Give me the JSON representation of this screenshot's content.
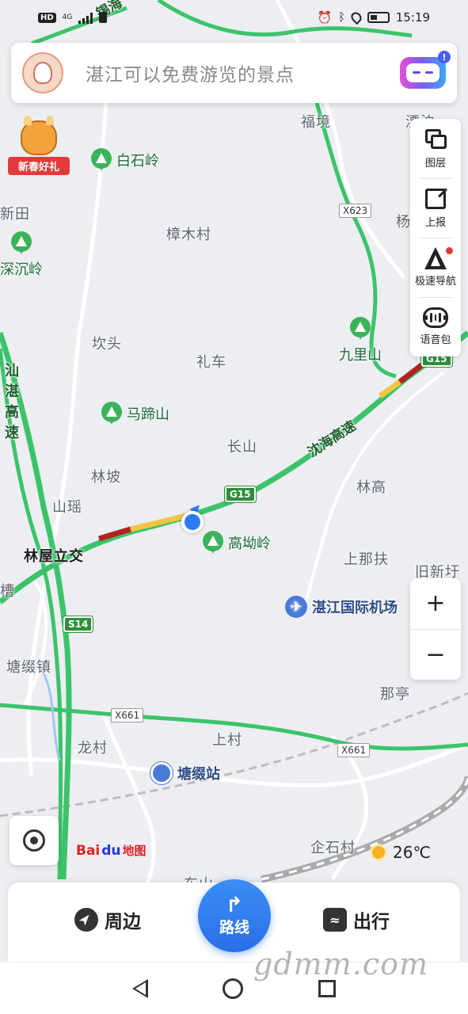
{
  "status": {
    "left_badges": [
      "HD",
      "4G"
    ],
    "time": "15:19"
  },
  "search": {
    "placeholder": "湛江可以免费游览的景点"
  },
  "promo": {
    "label": "新春好礼"
  },
  "tools": [
    {
      "label": "图层",
      "icon": "layers-icon"
    },
    {
      "label": "上报",
      "icon": "report-icon"
    },
    {
      "label": "极速导航",
      "icon": "navigation-icon"
    },
    {
      "label": "语音包",
      "icon": "voice-pack-icon"
    }
  ],
  "zoom": {
    "in": "+",
    "out": "−"
  },
  "map": {
    "places": [
      "福境",
      "漂泊",
      "新田",
      "樟木村",
      "坎头",
      "礼车",
      "长山",
      "林坡",
      "山瑶",
      "林高",
      "上那扶",
      "旧新圩",
      "塘缀镇",
      "那亭",
      "龙村",
      "上村",
      "企石村",
      "杨",
      "东山",
      "槽"
    ],
    "pois": [
      "白石岭",
      "深沉岭",
      "九里山",
      "马蹄山",
      "高坳岭"
    ],
    "interchange": "林屋立交",
    "airport": "湛江国际机场",
    "station": "塘缀站",
    "highway_name": "沈海高速",
    "vertical_highway": [
      "汕",
      "湛",
      "高",
      "速"
    ],
    "top_road": "锡海",
    "shields": [
      "G15",
      "G15",
      "S14"
    ],
    "county_roads": [
      "X623",
      "X661",
      "X661"
    ]
  },
  "brand": {
    "baidu": "Bai",
    "paw": "du",
    "map_text": "地图"
  },
  "weather": {
    "temp": "26℃"
  },
  "bottom": {
    "nearby": "周边",
    "route": "路线",
    "travel": "出行"
  },
  "watermark": "gdmm.com",
  "colors": {
    "road_green": "#3cc36a",
    "jam_red": "#b22222",
    "slow_yellow": "#f3c542",
    "accent_blue": "#2b7cf6"
  }
}
